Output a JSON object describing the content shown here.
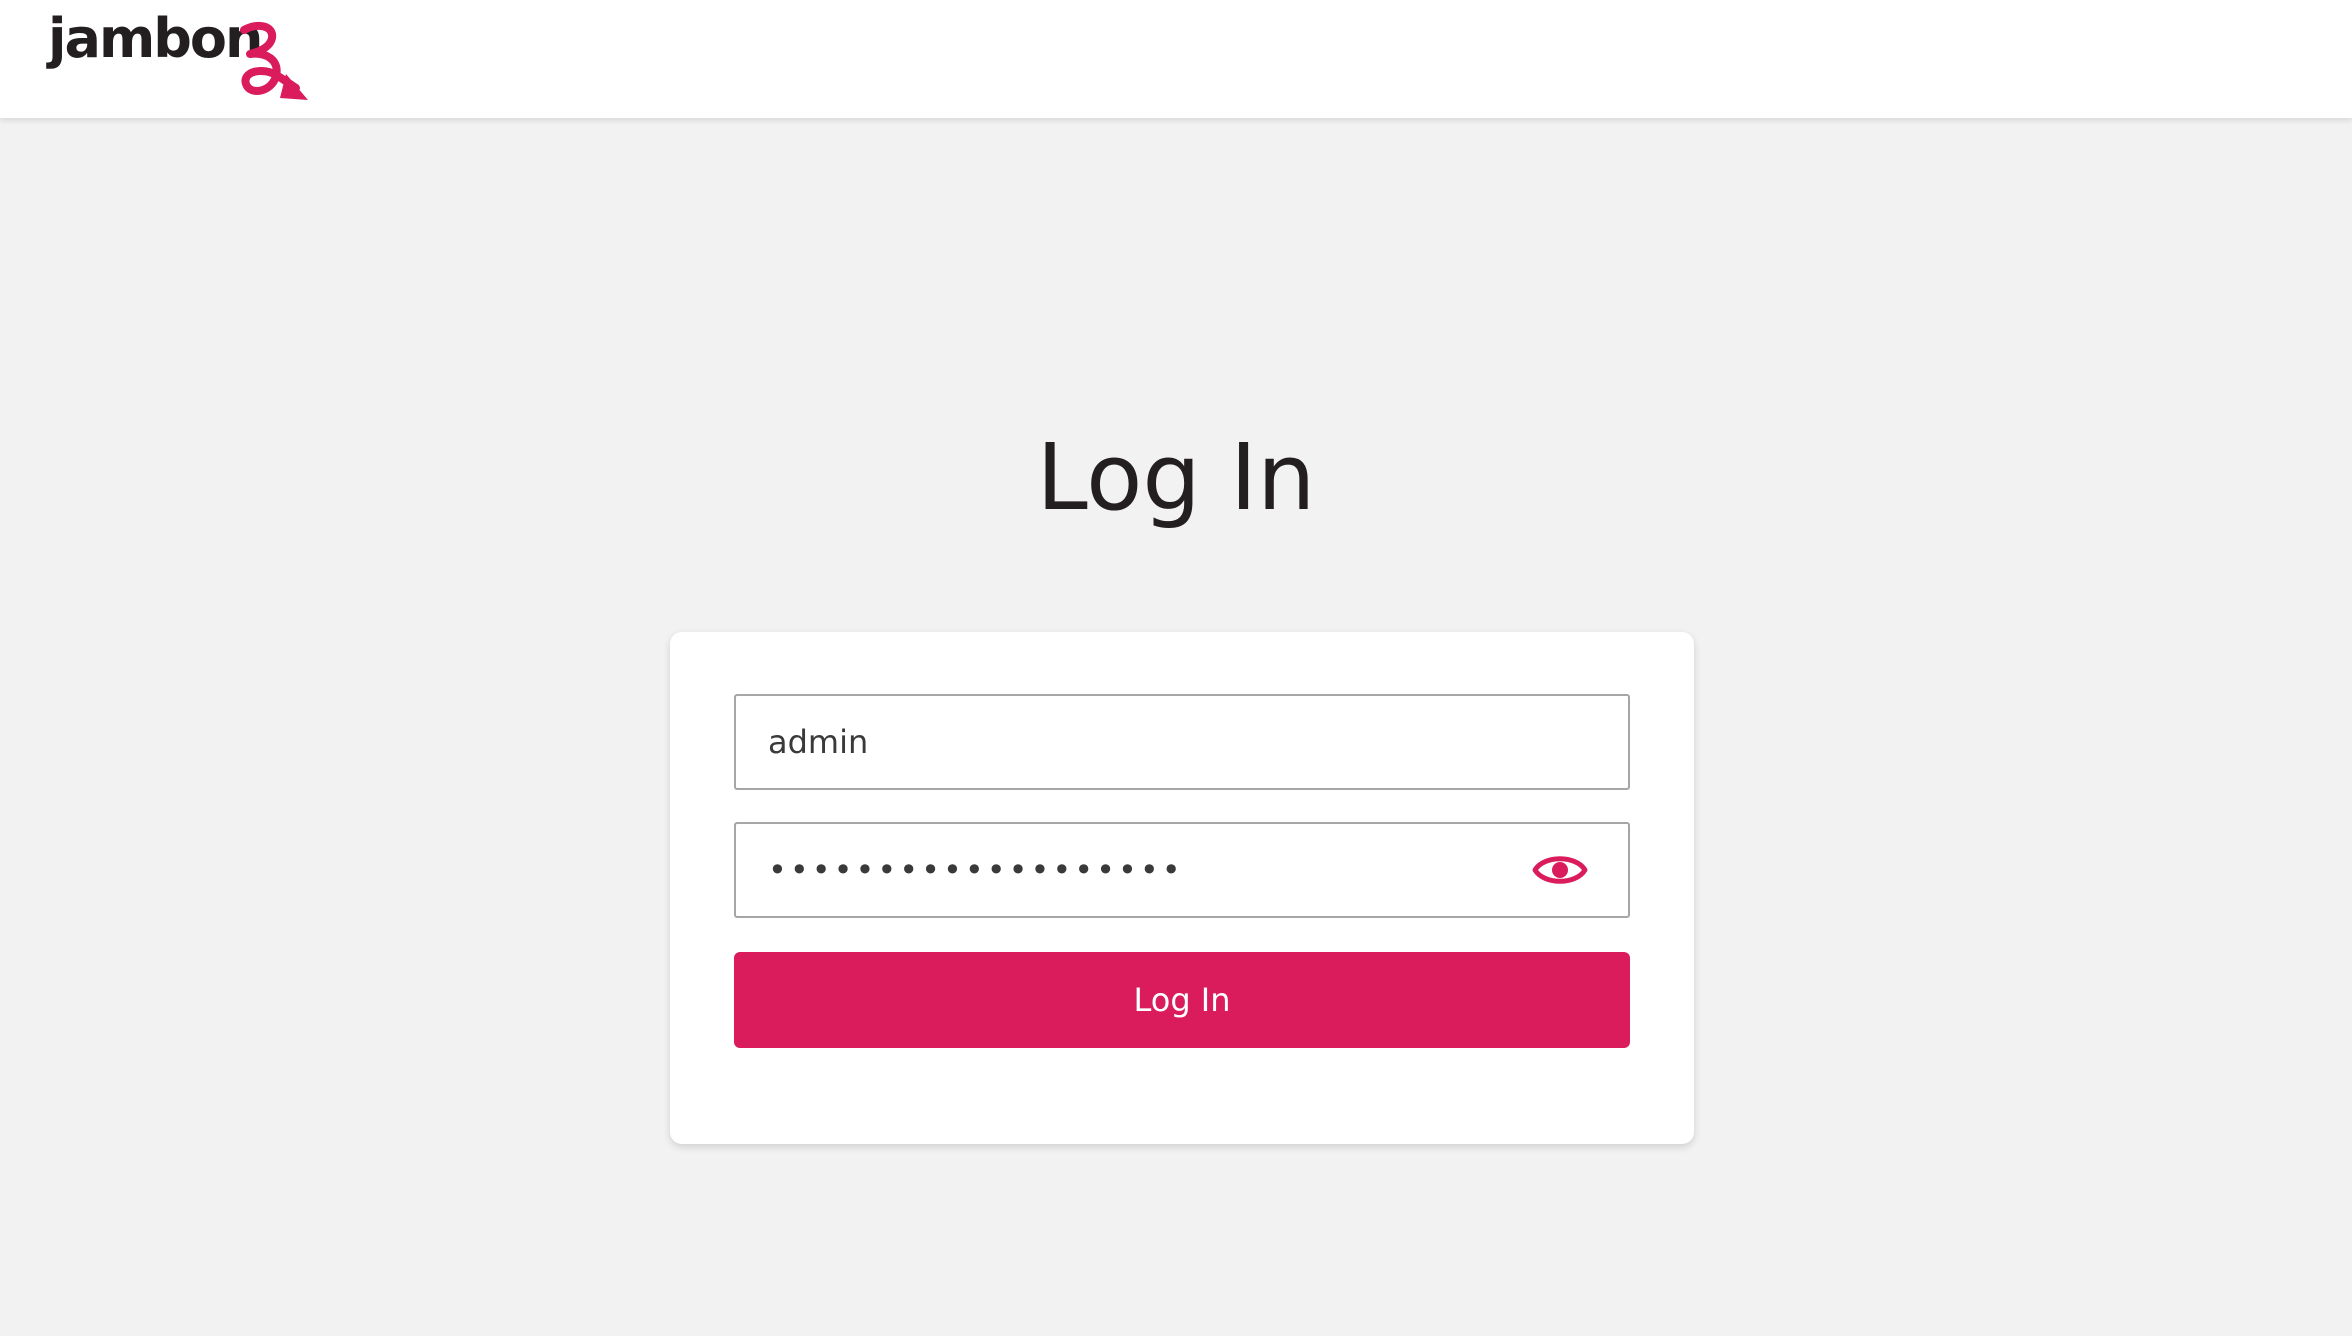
{
  "header": {
    "logo_text": "jambonz",
    "logo_wordmark": "jambon",
    "logo_icon": "jambonz-z-arrow-logo",
    "brand_color": "#da1c5c"
  },
  "main": {
    "title": "Log In",
    "form": {
      "username_value": "admin",
      "password_value": "•••••••••••••••••••",
      "show_password_icon": "eye-icon",
      "submit_label": "Log In"
    }
  },
  "colors": {
    "accent": "#da1c5c",
    "background": "#f2f2f2",
    "text": "#231f20"
  }
}
